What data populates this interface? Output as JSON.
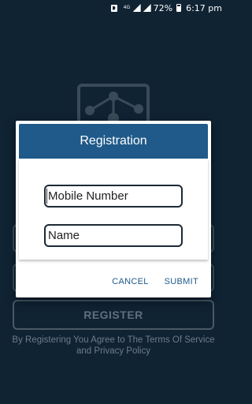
{
  "status_bar": {
    "network_label": "4G",
    "battery_percent": "72%",
    "time": "6:17 pm",
    "battery_level": 0.72,
    "icons": [
      "notification-icon",
      "network-4g-icon",
      "signal-icon",
      "signal-icon-2",
      "battery-icon"
    ]
  },
  "background": {
    "logo_icon": "network-logo-icon",
    "register_label": "REGISTER",
    "terms_text": "By Registering You Agree to The Terms Of Service and Privacy Policy"
  },
  "dialog": {
    "title": "Registration",
    "mobile_placeholder": "Mobile Number",
    "mobile_value": "",
    "name_placeholder": "Name",
    "name_value": "",
    "cancel_label": "CANCEL",
    "submit_label": "SUBMIT"
  },
  "colors": {
    "background": "#0f2333",
    "dialog_header": "#1f5a8a",
    "accent": "#1f5a8a"
  }
}
